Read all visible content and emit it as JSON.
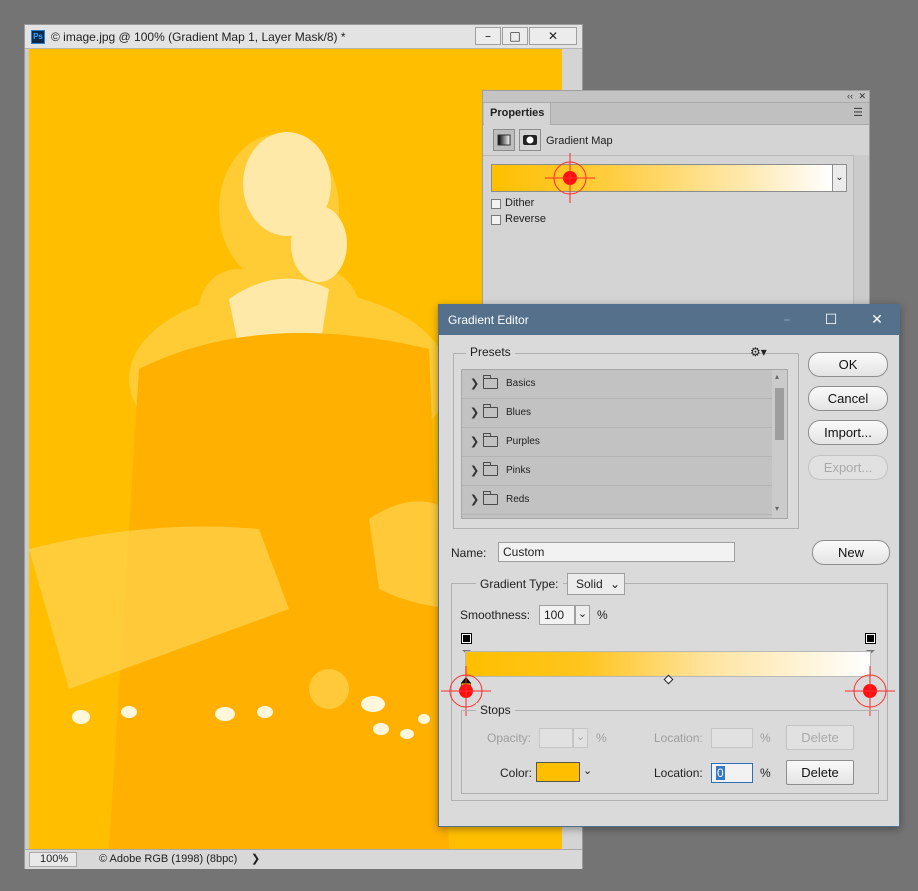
{
  "document": {
    "title": "© image.jpg @ 100% (Gradient Map 1, Layer Mask/8) *",
    "app_icon": "Ps",
    "window_controls": [
      "minimize-icon",
      "restore-icon",
      "close-icon"
    ],
    "zoom": "100%",
    "profile": "© Adobe RGB (1998) (8bpc)",
    "canvas_color": "#ffbf00"
  },
  "properties": {
    "tab": "Properties",
    "collapse": "‹‹",
    "adjustment": "Gradient Map",
    "dither": "Dither",
    "reverse": "Reverse"
  },
  "gradient_editor": {
    "title": "Gradient Editor",
    "presets_label": "Presets",
    "presets": [
      "Basics",
      "Blues",
      "Purples",
      "Pinks",
      "Reds"
    ],
    "buttons": {
      "ok": "OK",
      "cancel": "Cancel",
      "import": "Import...",
      "export": "Export...",
      "new": "New"
    },
    "name_label": "Name:",
    "name_value": "Custom",
    "gradient_type_label": "Gradient Type:",
    "gradient_type": "Solid",
    "smoothness_label": "Smoothness:",
    "smoothness": "100",
    "percent": "%",
    "stops_label": "Stops",
    "opacity_label": "Opacity:",
    "location_label": "Location:",
    "color_label": "Color:",
    "location_value": "0",
    "delete": "Delete",
    "gradient_colors": [
      "#ffbf00",
      "#ffffff"
    ],
    "stop_color": "#ffbf00"
  }
}
